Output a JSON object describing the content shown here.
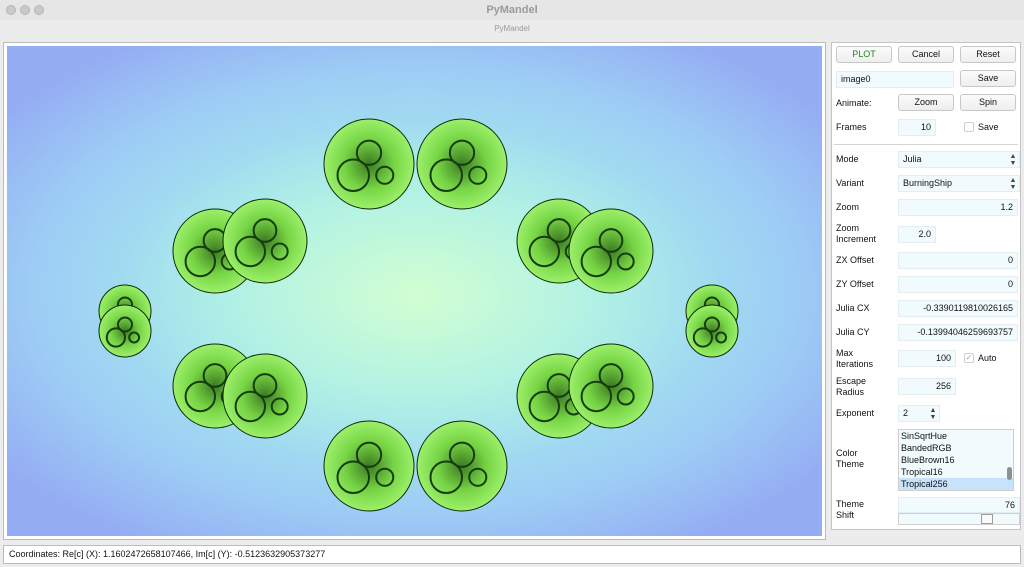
{
  "window": {
    "title": "PyMandel",
    "subtitle": "PyMandel"
  },
  "canvas": {
    "colors": {
      "background_center": "#b9f6e0",
      "background_edge": "#95aef3",
      "fractal_green": "#7fe04a",
      "fractal_dark": "#1e4a14"
    }
  },
  "controls": {
    "plot_label": "PLOT",
    "cancel_label": "Cancel",
    "reset_label": "Reset",
    "filename_value": "image0",
    "save_label": "Save",
    "animate_label": "Animate:",
    "zoom_anim_label": "Zoom",
    "spin_anim_label": "Spin",
    "frames_label": "Frames",
    "frames_value": "10",
    "save_frames_label": "Save",
    "save_frames_checked": false
  },
  "params": {
    "mode_label": "Mode",
    "mode_value": "Julia",
    "variant_label": "Variant",
    "variant_value": "BurningShip",
    "zoom_label": "Zoom",
    "zoom_value": "1.2",
    "zoom_increment_label_1": "Zoom",
    "zoom_increment_label_2": "Increment",
    "zoom_increment_value": "2.0",
    "zx_label": "ZX Offset",
    "zx_value": "0",
    "zy_label": "ZY Offset",
    "zy_value": "0",
    "julia_cx_label": "Julia CX",
    "julia_cx_value": "-0.3390119810026165",
    "julia_cy_label": "Julia CY",
    "julia_cy_value": "-0.13994046259693757",
    "max_iter_label_1": "Max",
    "max_iter_label_2": "Iterations",
    "max_iter_value": "100",
    "auto_label": "Auto",
    "auto_checked": true,
    "escape_label_1": "Escape",
    "escape_label_2": "Radius",
    "escape_value": "256",
    "exponent_label": "Exponent",
    "exponent_value": "2",
    "color_theme_label_1": "Color",
    "color_theme_label_2": "Theme",
    "color_themes": [
      "SinSqrtHue",
      "BandedRGB",
      "BlueBrown16",
      "Tropical16",
      "Tropical256"
    ],
    "selected_theme": "Tropical256",
    "theme_shift_label_1": "Theme",
    "theme_shift_label_2": "Shift",
    "theme_shift_value": "76",
    "theme_shift_fraction": 0.76
  },
  "status": {
    "text": "Coordinates: Re[c] (X): 1.1602472658107466,  Im[c] (Y): -0.5123632905373277"
  }
}
